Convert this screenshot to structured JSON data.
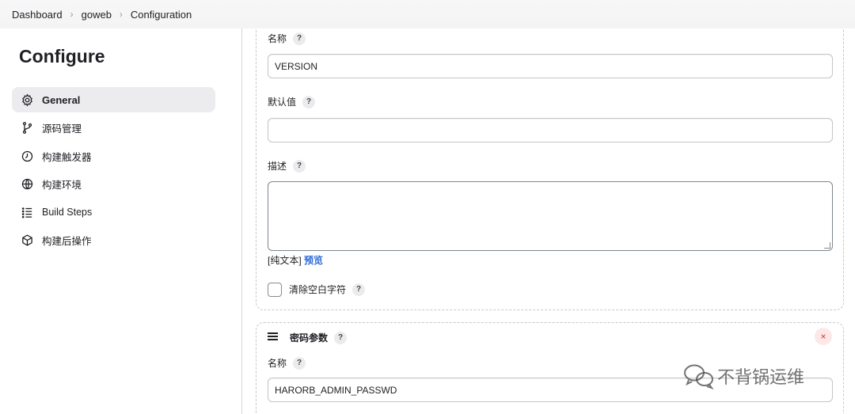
{
  "breadcrumb": [
    "Dashboard",
    "goweb",
    "Configuration"
  ],
  "sidebar": {
    "title": "Configure",
    "items": [
      {
        "label": "General",
        "icon": "gear-icon",
        "active": true
      },
      {
        "label": "源码管理",
        "icon": "branch-icon",
        "active": false
      },
      {
        "label": "构建触发器",
        "icon": "clock-icon",
        "active": false
      },
      {
        "label": "构建环境",
        "icon": "globe-icon",
        "active": false
      },
      {
        "label": "Build Steps",
        "icon": "list-icon",
        "active": false
      },
      {
        "label": "构建后操作",
        "icon": "cube-icon",
        "active": false
      }
    ]
  },
  "param1": {
    "name_label": "名称",
    "name_value": "VERSION",
    "default_label": "默认值",
    "default_value": "",
    "desc_label": "描述",
    "desc_value": "",
    "plain_text": "[纯文本]",
    "preview": "预览",
    "trim_label": "清除空白字符"
  },
  "param2": {
    "title": "密码参数",
    "name_label": "名称",
    "name_value": "HARORB_ADMIN_PASSWD",
    "close": "×"
  },
  "help_glyph": "?",
  "watermark": "不背锅运维"
}
